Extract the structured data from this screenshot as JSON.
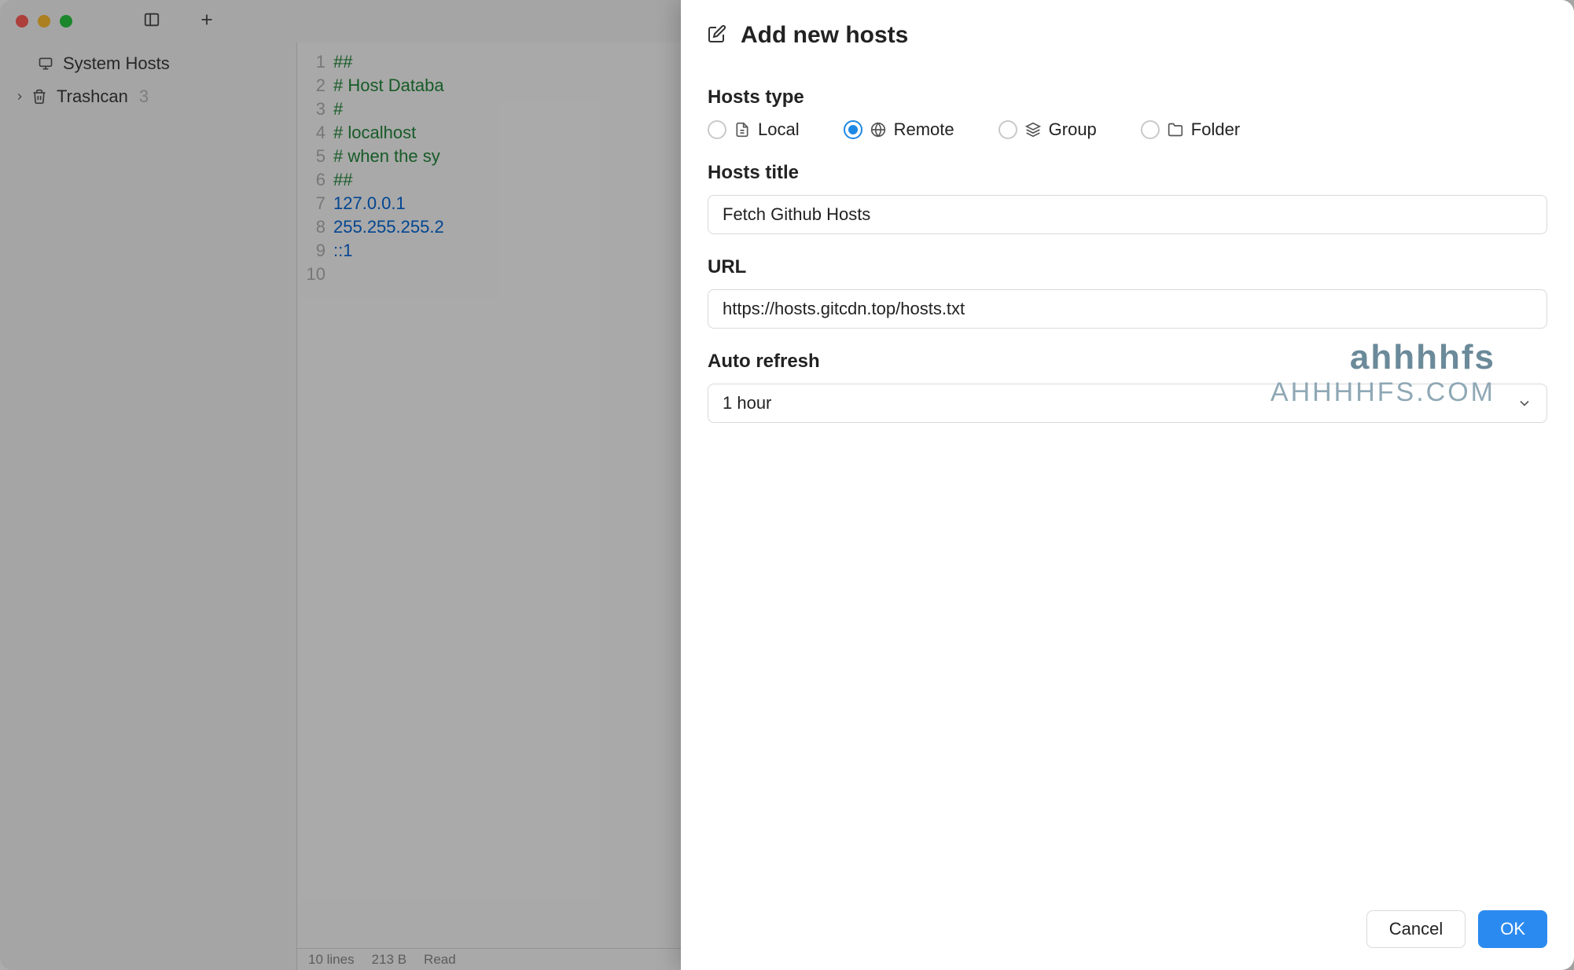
{
  "sidebar": {
    "system_hosts": "System Hosts",
    "trashcan": "Trashcan",
    "trashcan_count": "3"
  },
  "editor": {
    "lines": [
      {
        "n": 1,
        "text": "##",
        "cls": "c-green"
      },
      {
        "n": 2,
        "text": "# Host Databa",
        "cls": "c-green"
      },
      {
        "n": 3,
        "text": "#",
        "cls": "c-green"
      },
      {
        "n": 4,
        "text": "# localhost ",
        "cls": "c-green"
      },
      {
        "n": 5,
        "text": "# when the sy",
        "cls": "c-green"
      },
      {
        "n": 6,
        "text": "##",
        "cls": "c-green"
      },
      {
        "n": 7,
        "text": "127.0.0.1   ",
        "cls": "c-blue"
      },
      {
        "n": 8,
        "text": "255.255.255.2",
        "cls": "c-blue"
      },
      {
        "n": 9,
        "text": "::1",
        "cls": "c-blue"
      },
      {
        "n": 10,
        "text": "",
        "cls": ""
      }
    ]
  },
  "statusbar": {
    "lines": "10 lines",
    "size": "213 B",
    "mode": "Read"
  },
  "modal": {
    "title": "Add new hosts",
    "labels": {
      "hosts_type": "Hosts type",
      "hosts_title": "Hosts title",
      "url": "URL",
      "auto_refresh": "Auto refresh"
    },
    "types": {
      "local": "Local",
      "remote": "Remote",
      "group": "Group",
      "folder": "Folder",
      "selected": "remote"
    },
    "title_value": "Fetch Github Hosts",
    "url_value": "https://hosts.gitcdn.top/hosts.txt",
    "refresh_value": "1 hour",
    "buttons": {
      "cancel": "Cancel",
      "ok": "OK"
    }
  },
  "watermark": {
    "line1": "ahhhhfs",
    "line2": "AHHHHFS.COM"
  }
}
